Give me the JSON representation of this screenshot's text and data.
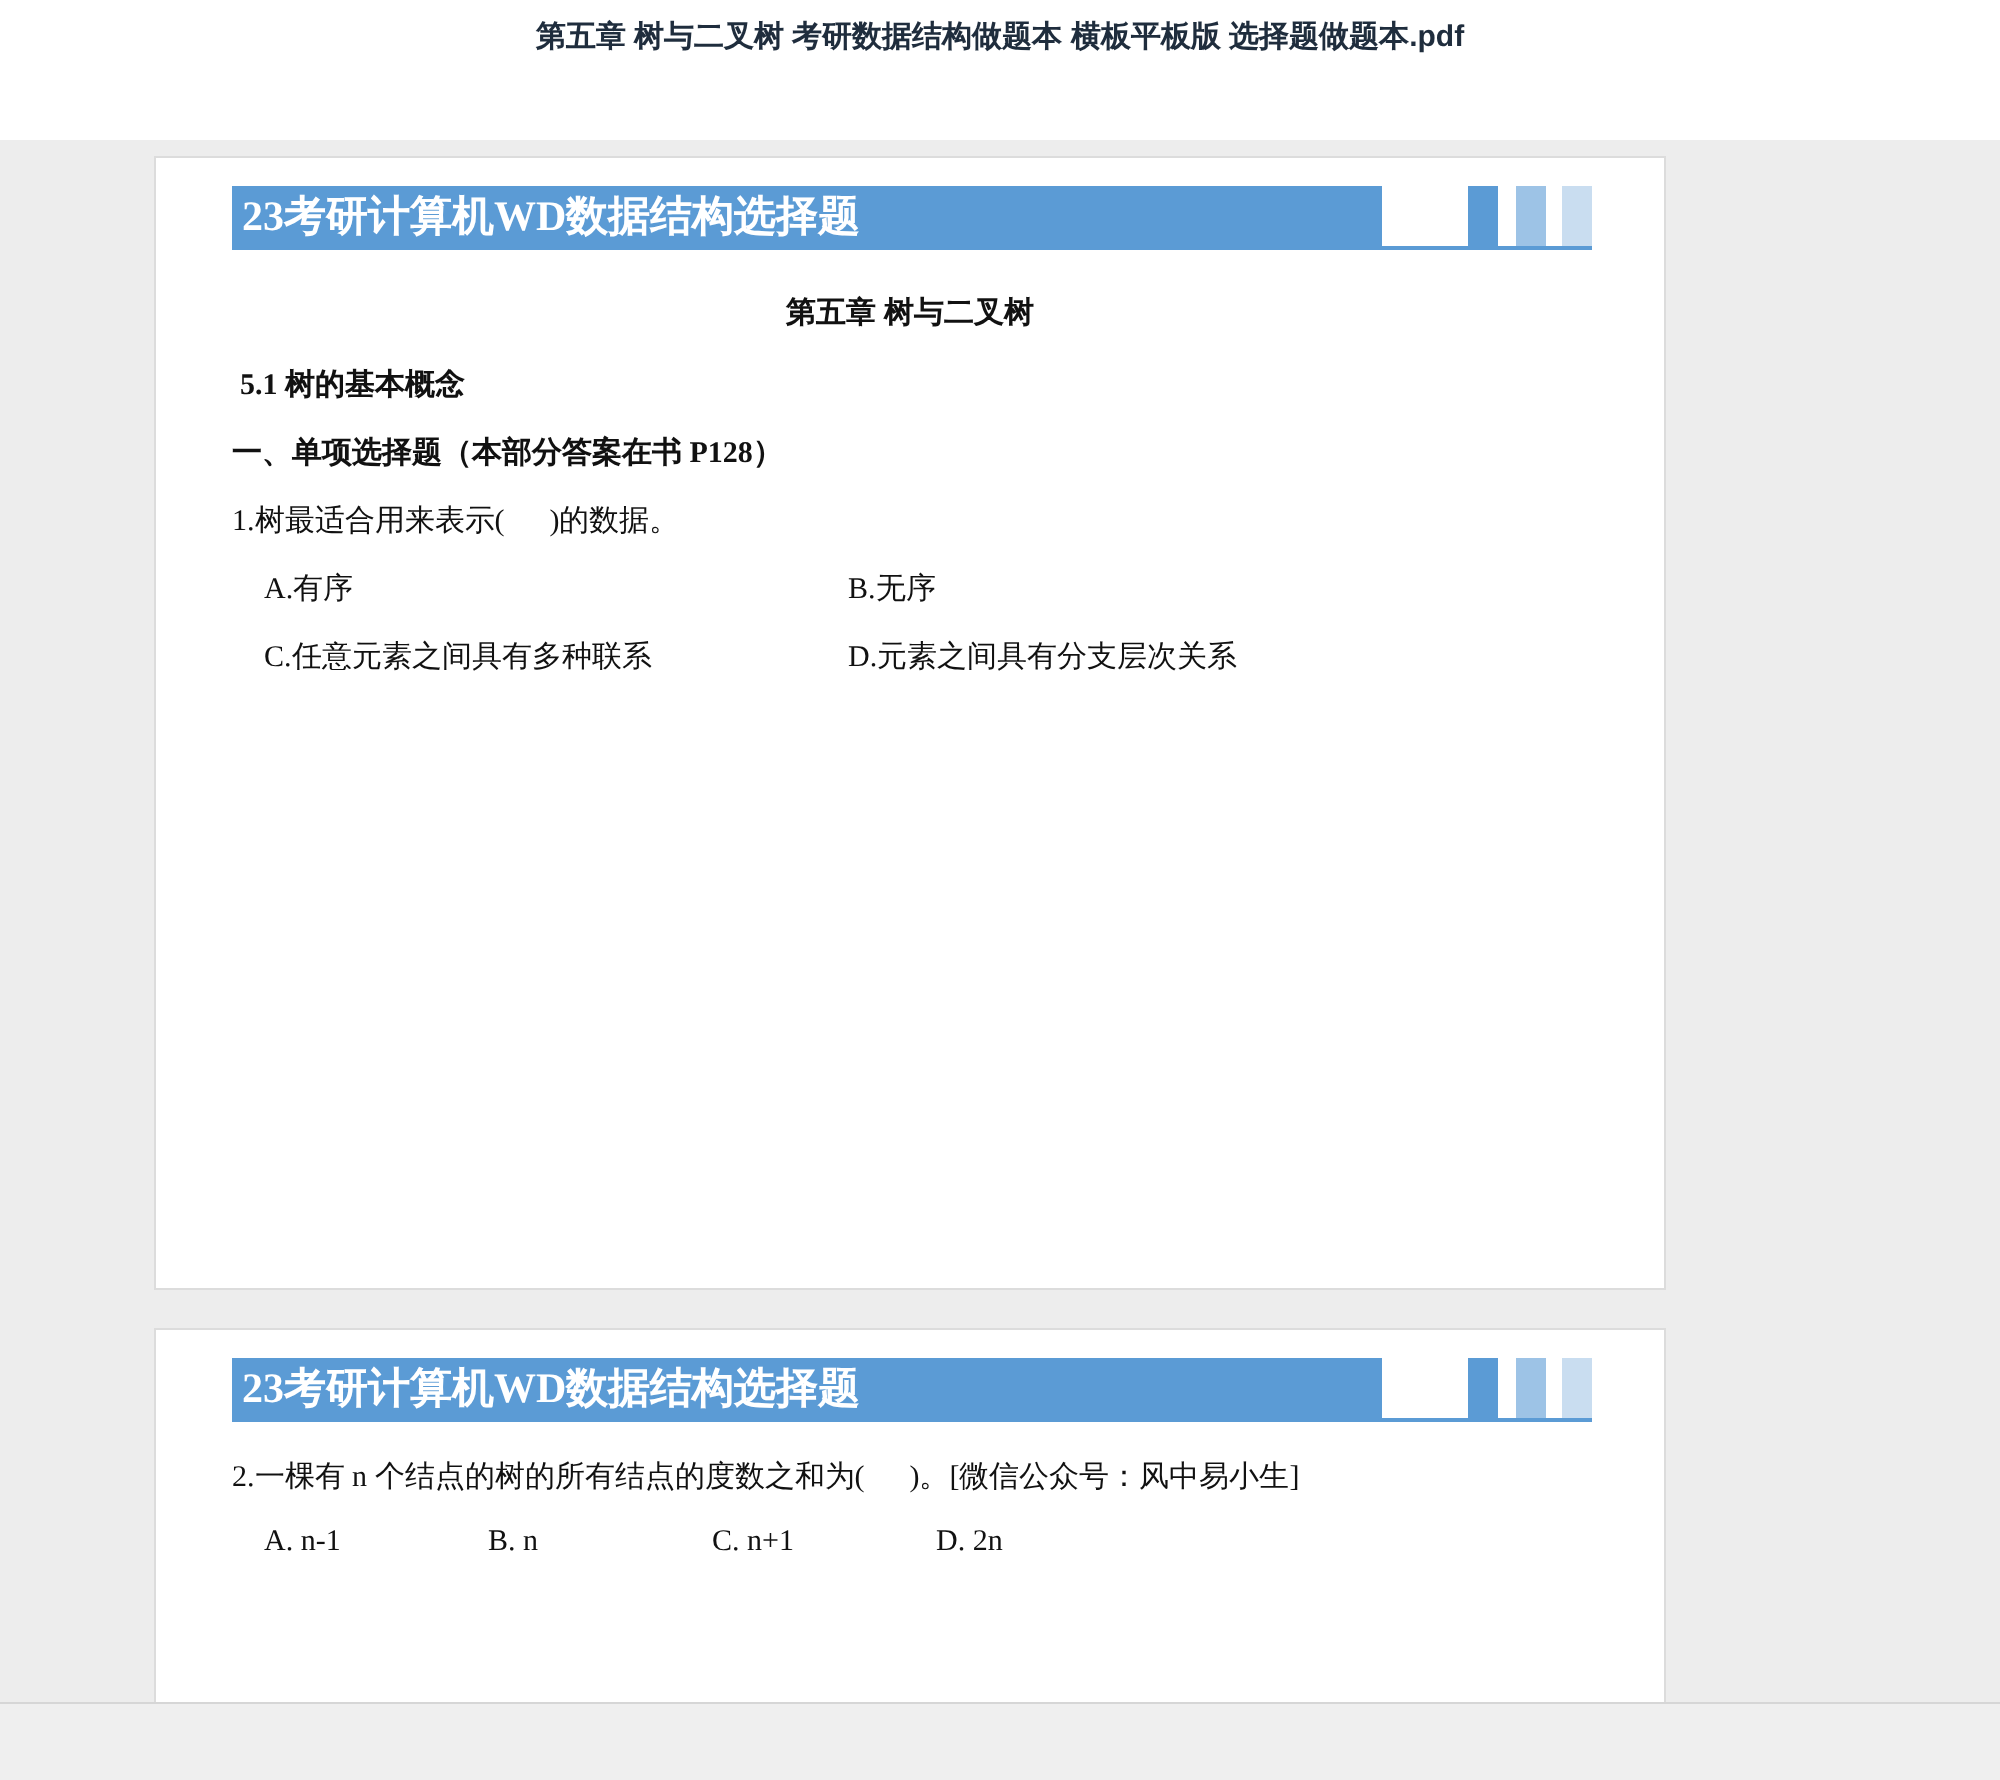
{
  "file_title": "第五章 树与二叉树 考研数据结构做题本 横板平板版 选择题做题本.pdf",
  "pages": [
    {
      "banner": "23考研计算机WD数据结构选择题",
      "blocks": [
        {
          "kind": "chapter",
          "text": "第五章  树与二叉树"
        },
        {
          "kind": "section",
          "text": "5.1 树的基本概念"
        },
        {
          "kind": "part",
          "text": "一、单项选择题（本部分答案在书 P128）"
        },
        {
          "kind": "grid",
          "text": "1.树最适合用来表示(      )的数据。",
          "options": [
            "A.有序",
            "B.无序",
            "C.任意元素之间具有多种联系",
            "D.元素之间具有分支层次关系"
          ]
        }
      ]
    },
    {
      "banner": "23考研计算机WD数据结构选择题",
      "blocks": [
        {
          "kind": "row",
          "text": "2.一棵有 n 个结点的树的所有结点的度数之和为(      )。[微信公众号：风中易小生]",
          "options": [
            "A. n-1",
            "B. n",
            "C. n+1",
            "D. 2n"
          ]
        }
      ]
    }
  ]
}
